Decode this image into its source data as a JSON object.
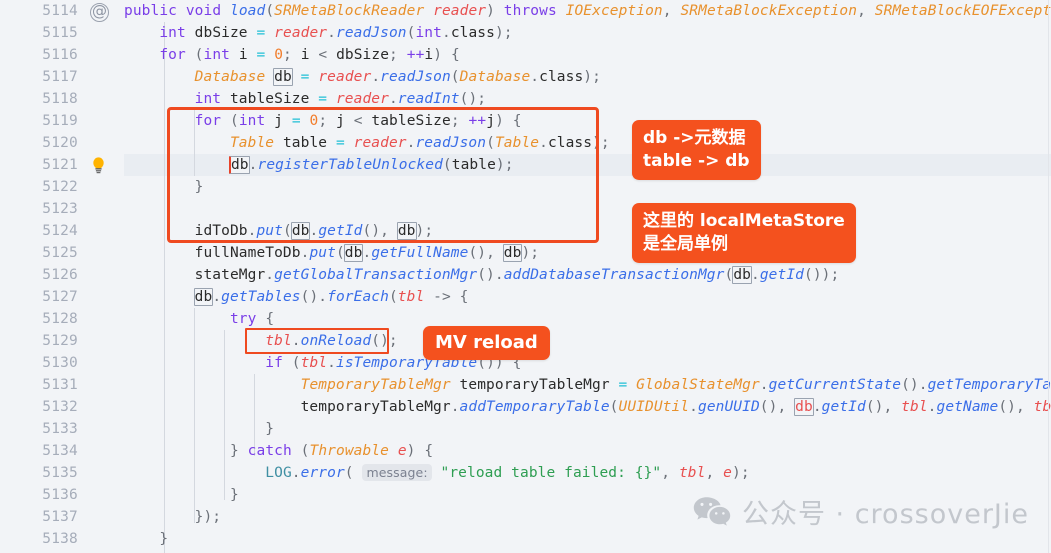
{
  "editor": {
    "first_line_number": 5114,
    "line_count": 25,
    "caret_line_number": 5121,
    "theme": "IntelliJ Light",
    "accent_color": "#f4511e",
    "highlight_row_color": "#e9edf2",
    "background_color": "#f2f4f7",
    "line_numbers": [
      "5114",
      "5115",
      "5116",
      "5117",
      "5118",
      "5119",
      "5120",
      "5121",
      "5122",
      "5123",
      "5124",
      "5125",
      "5126",
      "5127",
      "5128",
      "5129",
      "5130",
      "5131",
      "5132",
      "5133",
      "5134",
      "5135",
      "5136",
      "5137",
      "5138"
    ],
    "gutter_icons": [
      {
        "line": "5114",
        "name": "annotation-at-icon",
        "glyph": "@"
      },
      {
        "line": "5121",
        "name": "intention-bulb-icon",
        "glyph": "bulb"
      }
    ],
    "code_lines": [
      "    public void load(SRMetaBlockReader reader) throws IOException, SRMetaBlockException, SRMetaBlockEOFException {",
      "        int dbSize = reader.readJson(int.class);",
      "        for (int i = 0; i < dbSize; ++i) {",
      "            Database db = reader.readJson(Database.class);",
      "            int tableSize = reader.readInt();",
      "            for (int j = 0; j < tableSize; ++j) {",
      "                Table table = reader.readJson(Table.class);",
      "                db.registerTableUnlocked(table);",
      "            }",
      "",
      "            idToDb.put(db.getId(), db);",
      "            fullNameToDb.put(db.getFullName(), db);",
      "            stateMgr.getGlobalTransactionMgr().addDatabaseTransactionMgr(db.getId());",
      "            db.getTables().forEach(tbl -> {",
      "                try {",
      "                    tbl.onReload();",
      "                    if (tbl.isTemporaryTable()) {",
      "                        TemporaryTableMgr temporaryTableMgr = GlobalStateMgr.getCurrentState().getTemporaryTableMgr();",
      "                        temporaryTableMgr.addTemporaryTable(UUIDUtil.genUUID(), db.getId(), tbl.getName(), tbl.getId());",
      "                    }",
      "                } catch (Throwable e) {",
      "                    LOG.error( message: \"reload table failed: {}\", tbl, e);",
      "                }",
      "            });",
      "        }"
    ],
    "inline_hints": [
      {
        "line": "5135",
        "text": "message:"
      }
    ]
  },
  "annotations": {
    "callouts": [
      {
        "id": "db-meta",
        "name": "callout-db-metadata",
        "text": "db ->元数据\ntable -> db"
      },
      {
        "id": "local-meta-store",
        "name": "callout-local-meta-store",
        "text": "这里的 localMetaStore\n是全局单例"
      },
      {
        "id": "mv-reload",
        "name": "callout-mv-reload",
        "text": "MV reload"
      }
    ],
    "highlight_boxes": [
      {
        "id": "inner-for-loop",
        "name": "highlight-box-inner-for-loop"
      },
      {
        "id": "on-reload-call",
        "name": "highlight-box-on-reload-call"
      }
    ]
  },
  "watermark": {
    "icon": "wechat-icon",
    "text": "公众号 · crossoverJie"
  }
}
